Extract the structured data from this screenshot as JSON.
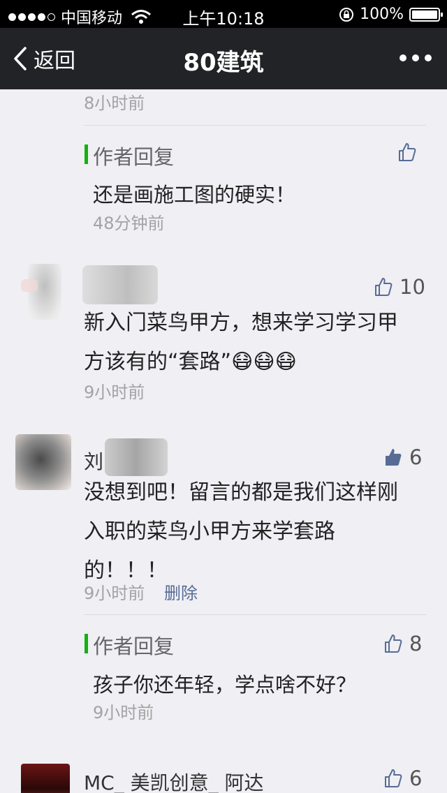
{
  "status_bar": {
    "carrier": "中国移动",
    "time": "上午10:18",
    "battery_percent": "100%",
    "battery_level": 1.0,
    "signal_bars_filled": 4,
    "signal_bars_total": 5
  },
  "nav": {
    "back_label": "返回",
    "title": "80建筑"
  },
  "comments_top_time": "8小时前",
  "reply_1": {
    "label": "作者回复",
    "text": "还是画施工图的硬实！",
    "time": "48分钟前"
  },
  "comment_1": {
    "like_count": "10",
    "text_line1": "新入门菜鸟甲方，想来学习学习甲",
    "text_line2": "方该有的“套路”",
    "emoji": [
      "😷",
      "😷",
      "😷"
    ],
    "time": "9小时前"
  },
  "comment_2": {
    "nickname_visible": "刘",
    "like_count": "6",
    "text": "没想到吧！留言的都是我们这样刚入职的菜鸟小甲方来学套路的！！！",
    "text_line1": "没想到吧！留言的都是我们这样刚",
    "text_line2": "入职的菜鸟小甲方来学套路",
    "text_line3": "的！！！",
    "time": "9小时前",
    "delete_label": "删除"
  },
  "reply_2": {
    "label": "作者回复",
    "text": "孩子你还年轻，学点啥不好？",
    "time": "9小时前",
    "like_count": "8"
  },
  "comment_3": {
    "nickname": "MC_ 美凯创意_ 阿达",
    "like_count": "6"
  },
  "colors": {
    "status_bar_bg": "#000000",
    "nav_bg": "#222326",
    "page_bg": "#efeff4",
    "reply_accent": "#12b10f",
    "link": "#576b95",
    "liked_thumb": "#576b95"
  }
}
